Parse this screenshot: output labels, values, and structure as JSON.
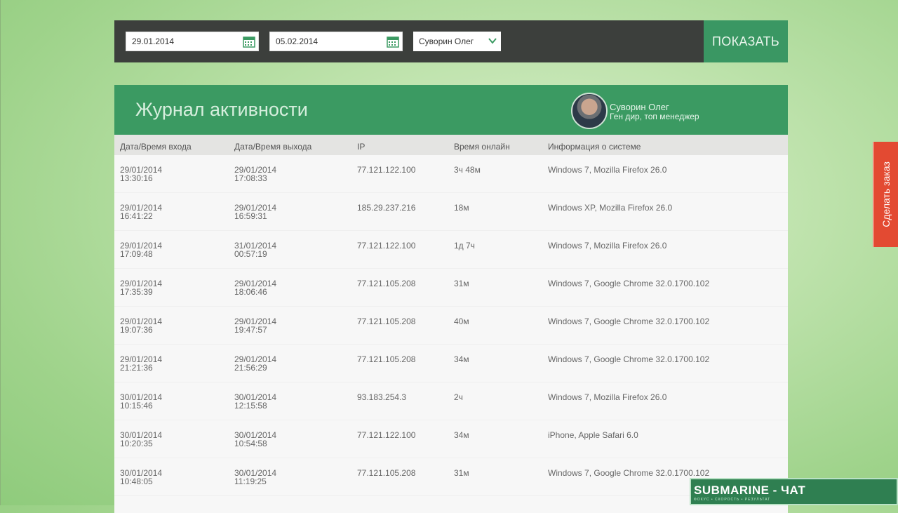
{
  "filters": {
    "date_from": "29.01.2014",
    "date_to": "05.02.2014",
    "user_select": "Суворин Олег",
    "show_button": "ПОКАЗАТЬ"
  },
  "panel": {
    "title": "Журнал активности",
    "user": {
      "name": "Суворин Олег",
      "role": "Ген дир, топ менеджер"
    }
  },
  "table": {
    "headers": [
      "Дата/Время входа",
      "Дата/Время выхода",
      "IP",
      "Время онлайн",
      "Информация о системе"
    ],
    "rows": [
      [
        "29/01/2014",
        "13:30:16",
        "29/01/2014",
        "17:08:33",
        "77.121.122.100",
        "3ч 48м",
        "Windows 7, Mozilla Firefox 26.0"
      ],
      [
        "29/01/2014",
        "16:41:22",
        "29/01/2014",
        "16:59:31",
        "185.29.237.216",
        "18м",
        "Windows XP, Mozilla Firefox 26.0"
      ],
      [
        "29/01/2014",
        "17:09:48",
        "31/01/2014",
        "00:57:19",
        "77.121.122.100",
        "1д 7ч",
        "Windows 7, Mozilla Firefox 26.0"
      ],
      [
        "29/01/2014",
        "17:35:39",
        "29/01/2014",
        "18:06:46",
        "77.121.105.208",
        "31м",
        "Windows 7, Google Chrome 32.0.1700.102"
      ],
      [
        "29/01/2014",
        "19:07:36",
        "29/01/2014",
        "19:47:57",
        "77.121.105.208",
        "40м",
        "Windows 7, Google Chrome 32.0.1700.102"
      ],
      [
        "29/01/2014",
        "21:21:36",
        "29/01/2014",
        "21:56:29",
        "77.121.105.208",
        "34м",
        "Windows 7, Google Chrome 32.0.1700.102"
      ],
      [
        "30/01/2014",
        "10:15:46",
        "30/01/2014",
        "12:15:58",
        "93.183.254.3",
        "2ч",
        "Windows 7, Mozilla Firefox 26.0"
      ],
      [
        "30/01/2014",
        "10:20:35",
        "30/01/2014",
        "10:54:58",
        "77.121.122.100",
        "34м",
        "iPhone, Apple Safari 6.0"
      ],
      [
        "30/01/2014",
        "10:48:05",
        "30/01/2014",
        "11:19:25",
        "77.121.105.208",
        "31м",
        "Windows 7, Google Chrome 32.0.1700.102"
      ]
    ]
  },
  "side_tab": {
    "label": "Сделать заказ"
  },
  "chat": {
    "brand": "SUBMARINE - ЧАТ",
    "tagline": "ФОКУС • СКОРОСТЬ • РЕЗУЛЬТАТ"
  },
  "colors": {
    "accent": "#3b9a62",
    "bar": "#3c3f3c",
    "order": "#e34a32"
  }
}
